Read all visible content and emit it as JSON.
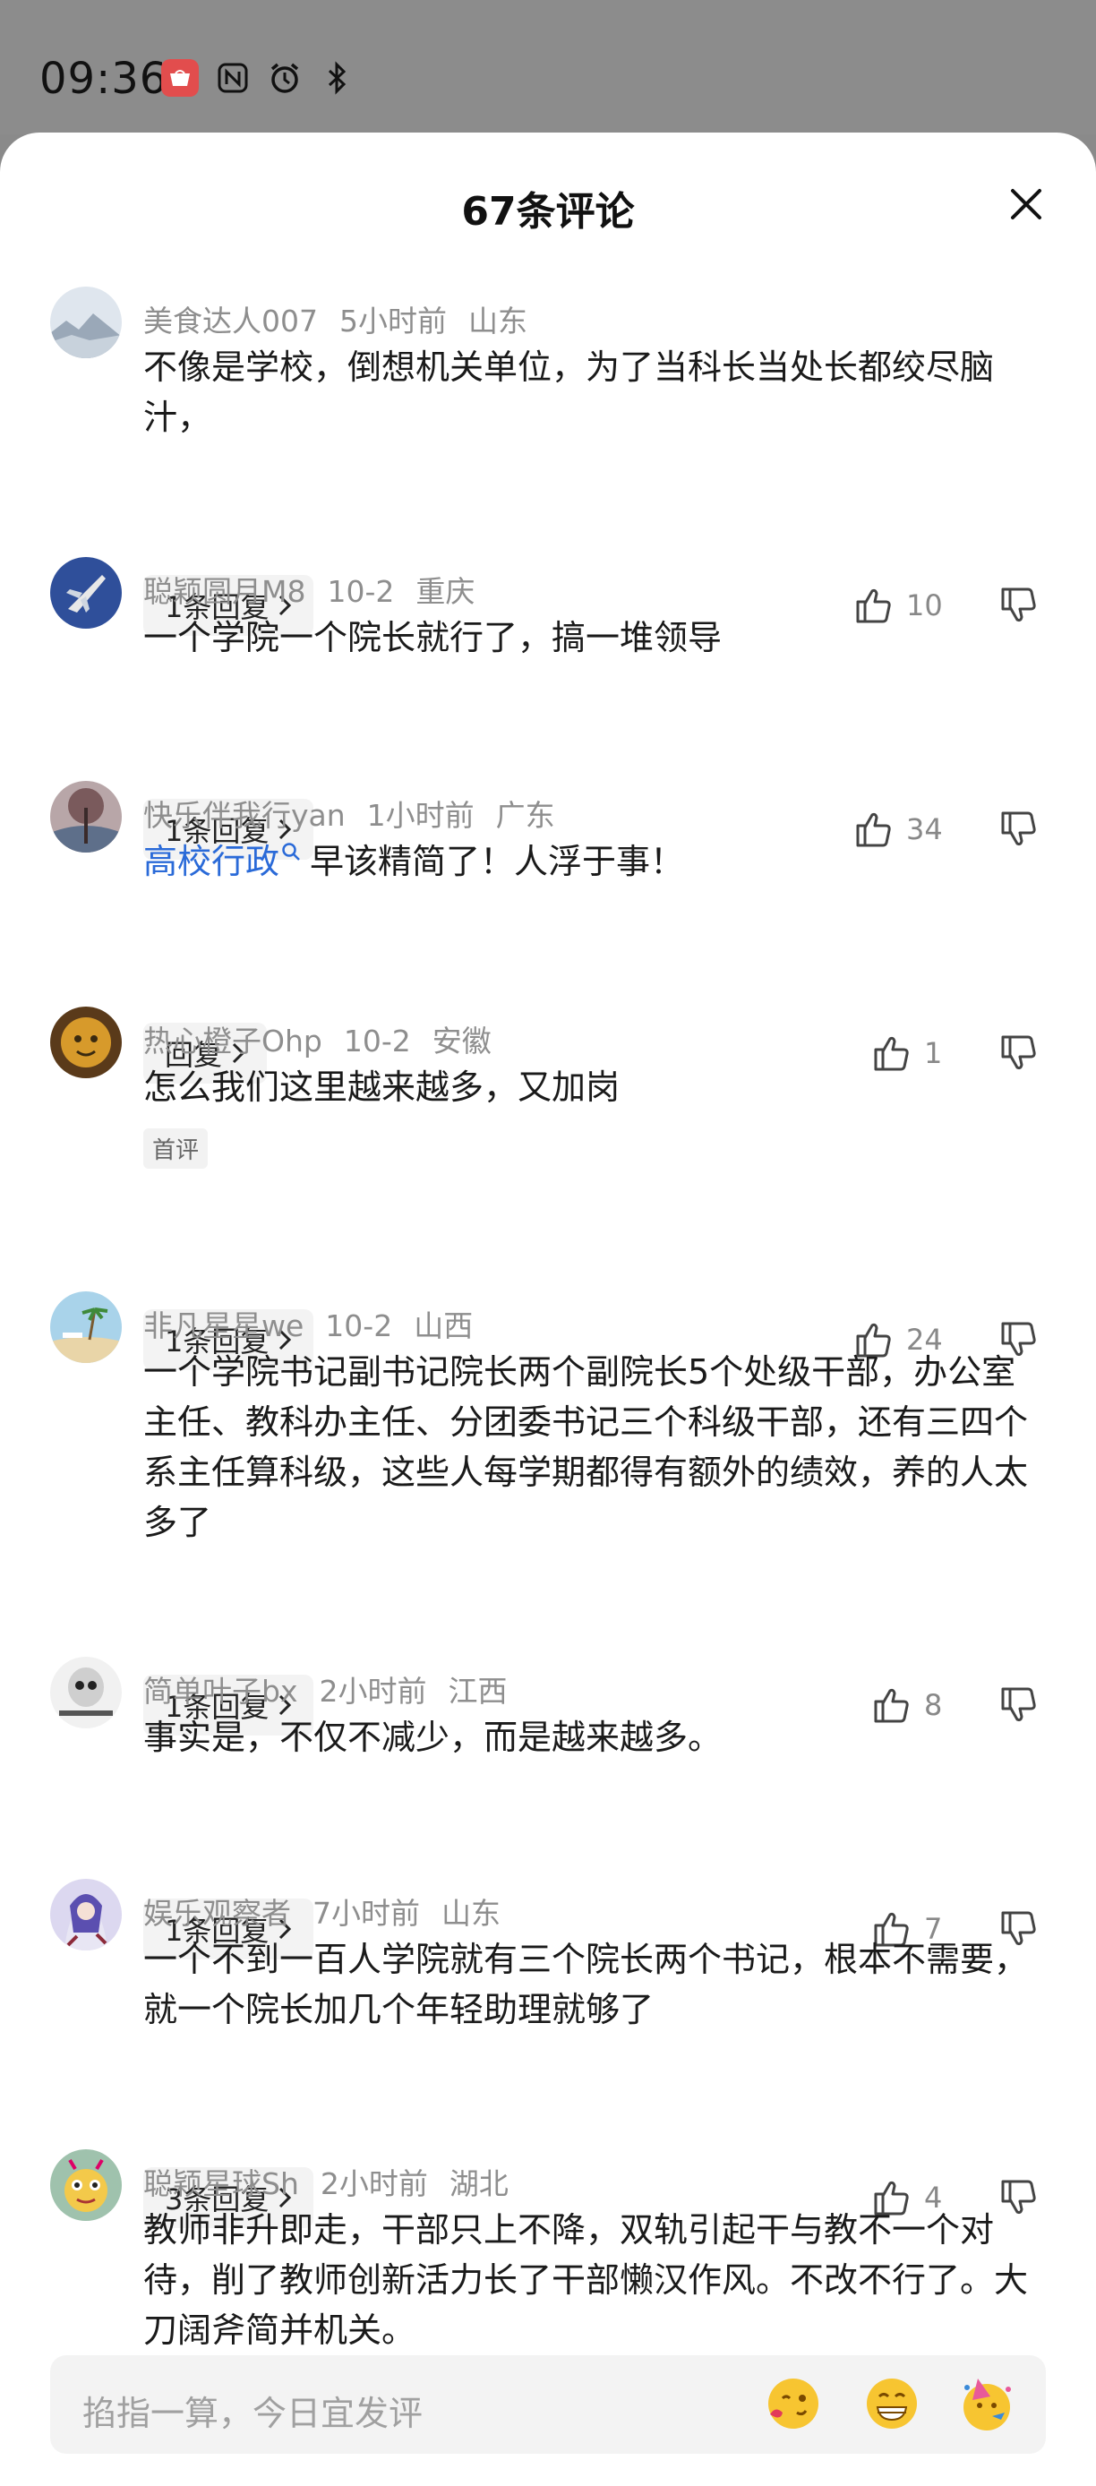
{
  "status_bar": {
    "time": "09:36",
    "app_badge": "HUAWEI"
  },
  "header": {
    "title": "67条评论"
  },
  "comments": [
    {
      "user": "美食达人007",
      "time": "5小时前",
      "location": "山东",
      "text": "不像是学校，倒想机关单位，为了当科长当处长都绞尽脑汁，",
      "replies": "1条回复",
      "likes": "10"
    },
    {
      "user": "聪颖圆月M8",
      "time": "10-2",
      "location": "重庆",
      "text": "一个学院一个院长就行了，搞一堆领导",
      "replies": "1条回复",
      "likes": "34"
    },
    {
      "user": "快乐伴我行yan",
      "time": "1小时前",
      "location": "广东",
      "mention": "高校行政",
      "text": "早该精简了！人浮于事！",
      "replies": "回复",
      "likes": "1"
    },
    {
      "user": "热心橙子Ohp",
      "time": "10-2",
      "location": "安徽",
      "text": "怎么我们这里越来越多，又加岗",
      "tag": "首评",
      "replies": "1条回复",
      "likes": "24"
    },
    {
      "user": "非凡星星we",
      "time": "10-2",
      "location": "山西",
      "text": "一个学院书记副书记院长两个副院长5个处级干部，办公室主任、教科办主任、分团委书记三个科级干部，还有三四个系主任算科级，这些人每学期都得有额外的绩效，养的人太多了",
      "replies": "1条回复",
      "likes": "8"
    },
    {
      "user": "简单叶子bx",
      "time": "2小时前",
      "location": "江西",
      "text": "事实是，不仅不减少，而是越来越多。",
      "replies": "1条回复",
      "likes": "7"
    },
    {
      "user": "娱乐观察者",
      "time": "7小时前",
      "location": "山东",
      "text": "一个不到一百人学院就有三个院长两个书记，根本不需要，就一个院长加几个年轻助理就够了",
      "replies": "3条回复",
      "likes": "4"
    },
    {
      "user": "聪颖星球Sh",
      "time": "2小时前",
      "location": "湖北",
      "text": "教师非升即走，干部只上不降，双轨引起干与教不一个对待，削了教师创新活力长了干部懒汉作风。不改不行了。大刀阔斧简并机关。"
    }
  ],
  "input": {
    "placeholder": "掐指一算，今日宜发评"
  },
  "colors": {
    "mention": "#2a6ad8",
    "meta": "#8e8e8e",
    "sheet": "#ffffff",
    "scrim": "#8a8a8a"
  }
}
